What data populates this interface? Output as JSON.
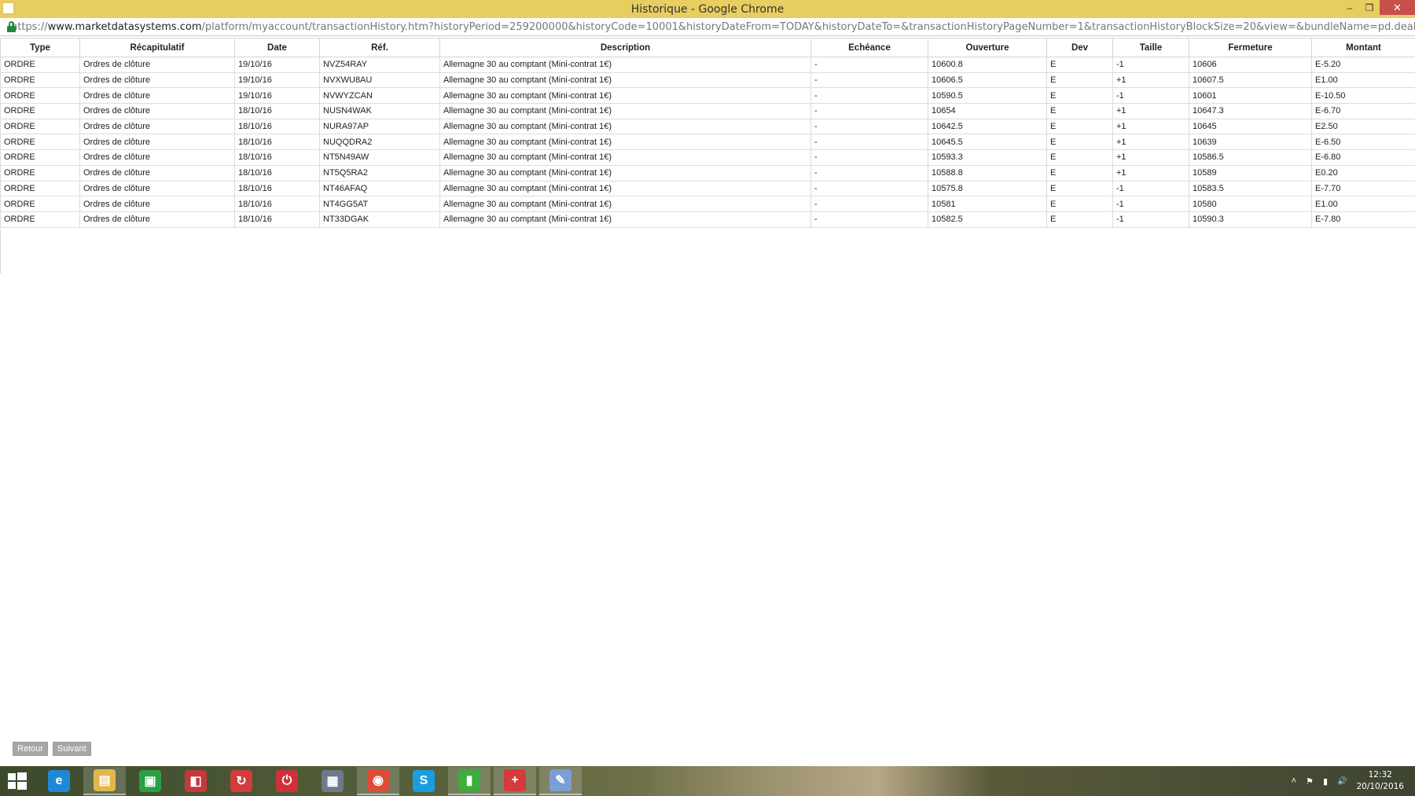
{
  "window": {
    "title": "Historique - Google Chrome",
    "minimize": "–",
    "maximize": "❐",
    "close": "✕"
  },
  "address": {
    "scheme": "https://",
    "host": "www.marketdatasystems.com",
    "path": "/platform/myaccount/transactionHistory.htm?historyPeriod=259200000&historyCode=10001&historyDateFrom=TODAY&historyDateTo=&transactionHistoryPageNumber=1&transactionHistoryBlockSize=20&view=&bundleName=pd.dealing&rb-last=last&rb-from-to="
  },
  "table": {
    "headers": {
      "type": "Type",
      "recap": "Récapitulatif",
      "date": "Date",
      "ref": "Réf.",
      "description": "Description",
      "echeance": "Echéance",
      "ouverture": "Ouverture",
      "dev": "Dev",
      "taille": "Taille",
      "fermeture": "Fermeture",
      "montant": "Montant"
    },
    "rows": [
      {
        "type": "ORDRE",
        "recap": "Ordres de clôture",
        "date": "19/10/16",
        "ref": "NVZ54RAY",
        "description": "Allemagne 30 au comptant (Mini-contrat 1€)",
        "echeance": "-",
        "ouverture": "10600.8",
        "dev": "E",
        "taille": "-1",
        "fermeture": "10606",
        "montant": "E-5.20"
      },
      {
        "type": "ORDRE",
        "recap": "Ordres de clôture",
        "date": "19/10/16",
        "ref": "NVXWU8AU",
        "description": "Allemagne 30 au comptant (Mini-contrat 1€)",
        "echeance": "-",
        "ouverture": "10606.5",
        "dev": "E",
        "taille": "+1",
        "fermeture": "10607.5",
        "montant": "E1.00"
      },
      {
        "type": "ORDRE",
        "recap": "Ordres de clôture",
        "date": "19/10/16",
        "ref": "NVWYZCAN",
        "description": "Allemagne 30 au comptant (Mini-contrat 1€)",
        "echeance": "-",
        "ouverture": "10590.5",
        "dev": "E",
        "taille": "-1",
        "fermeture": "10601",
        "montant": "E-10.50"
      },
      {
        "type": "ORDRE",
        "recap": "Ordres de clôture",
        "date": "18/10/16",
        "ref": "NUSN4WAK",
        "description": "Allemagne 30 au comptant (Mini-contrat 1€)",
        "echeance": "-",
        "ouverture": "10654",
        "dev": "E",
        "taille": "+1",
        "fermeture": "10647.3",
        "montant": "E-6.70"
      },
      {
        "type": "ORDRE",
        "recap": "Ordres de clôture",
        "date": "18/10/16",
        "ref": "NURA97AP",
        "description": "Allemagne 30 au comptant (Mini-contrat 1€)",
        "echeance": "-",
        "ouverture": "10642.5",
        "dev": "E",
        "taille": "+1",
        "fermeture": "10645",
        "montant": "E2.50"
      },
      {
        "type": "ORDRE",
        "recap": "Ordres de clôture",
        "date": "18/10/16",
        "ref": "NUQQDRA2",
        "description": "Allemagne 30 au comptant (Mini-contrat 1€)",
        "echeance": "-",
        "ouverture": "10645.5",
        "dev": "E",
        "taille": "+1",
        "fermeture": "10639",
        "montant": "E-6.50"
      },
      {
        "type": "ORDRE",
        "recap": "Ordres de clôture",
        "date": "18/10/16",
        "ref": "NT5N49AW",
        "description": "Allemagne 30 au comptant (Mini-contrat 1€)",
        "echeance": "-",
        "ouverture": "10593.3",
        "dev": "E",
        "taille": "+1",
        "fermeture": "10586.5",
        "montant": "E-6.80"
      },
      {
        "type": "ORDRE",
        "recap": "Ordres de clôture",
        "date": "18/10/16",
        "ref": "NT5Q5RA2",
        "description": "Allemagne 30 au comptant (Mini-contrat 1€)",
        "echeance": "-",
        "ouverture": "10588.8",
        "dev": "E",
        "taille": "+1",
        "fermeture": "10589",
        "montant": "E0.20"
      },
      {
        "type": "ORDRE",
        "recap": "Ordres de clôture",
        "date": "18/10/16",
        "ref": "NT46AFAQ",
        "description": "Allemagne 30 au comptant (Mini-contrat 1€)",
        "echeance": "-",
        "ouverture": "10575.8",
        "dev": "E",
        "taille": "-1",
        "fermeture": "10583.5",
        "montant": "E-7.70"
      },
      {
        "type": "ORDRE",
        "recap": "Ordres de clôture",
        "date": "18/10/16",
        "ref": "NT4GG5AT",
        "description": "Allemagne 30 au comptant (Mini-contrat 1€)",
        "echeance": "-",
        "ouverture": "10581",
        "dev": "E",
        "taille": "-1",
        "fermeture": "10580",
        "montant": "E1.00"
      },
      {
        "type": "ORDRE",
        "recap": "Ordres de clôture",
        "date": "18/10/16",
        "ref": "NT33DGAK",
        "description": "Allemagne 30 au comptant (Mini-contrat 1€)",
        "echeance": "-",
        "ouverture": "10582.5",
        "dev": "E",
        "taille": "-1",
        "fermeture": "10590.3",
        "montant": "E-7.80"
      }
    ]
  },
  "pager": {
    "back": "Retour",
    "next": "Suivant"
  },
  "taskbar": {
    "items": [
      {
        "icon": "internet-explorer-icon",
        "glyph": "e",
        "color": "#1e88d8"
      },
      {
        "icon": "file-explorer-icon",
        "glyph": "▤",
        "color": "#e2b74a"
      },
      {
        "icon": "store-icon",
        "glyph": "▣",
        "color": "#2aa043"
      },
      {
        "icon": "app-red-icon",
        "glyph": "◧",
        "color": "#c23a3a"
      },
      {
        "icon": "sync-icon",
        "glyph": "↻",
        "color": "#d23c3c"
      },
      {
        "icon": "power-app-icon",
        "glyph": "⏻",
        "color": "#d0303a"
      },
      {
        "icon": "network-app-icon",
        "glyph": "▦",
        "color": "#6e7a8a"
      },
      {
        "icon": "chrome-icon",
        "glyph": "◉",
        "color": "#dd4b39"
      },
      {
        "icon": "skype-icon",
        "glyph": "S",
        "color": "#1a9ee0"
      },
      {
        "icon": "trading-chart-icon",
        "glyph": "▮",
        "color": "#3cae3c"
      },
      {
        "icon": "medical-plus-icon",
        "glyph": "+",
        "color": "#d63a3a"
      },
      {
        "icon": "paint-icon",
        "glyph": "✎",
        "color": "#7a9ed6"
      }
    ],
    "clock_time": "12:32",
    "clock_date": "20/10/2016",
    "tray_chevron": "˄",
    "tray_flag": "⚑",
    "tray_network": "▮",
    "tray_volume": "🔊"
  }
}
